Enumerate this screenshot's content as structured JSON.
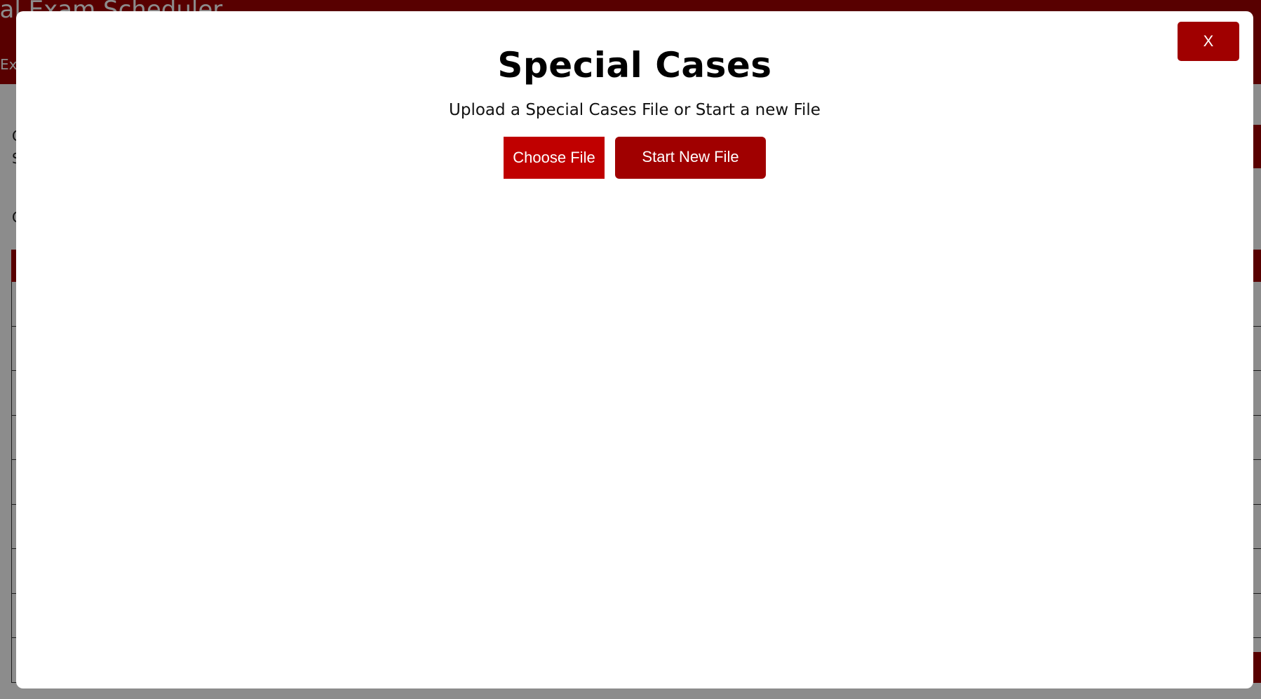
{
  "background": {
    "app_title": "nal Exam Scheduler",
    "nav_item": "Exp",
    "side_text_1": "C",
    "side_text_2": "S",
    "side_text_3": "C"
  },
  "modal": {
    "title": "Special Cases",
    "subtitle": "Upload a Special Cases File or Start a new File",
    "choose_file_label": "Choose File",
    "start_new_label": "Start New File",
    "close_label": "X"
  },
  "colors": {
    "accent": "#a00000",
    "choose_file_bg": "#c00000"
  }
}
